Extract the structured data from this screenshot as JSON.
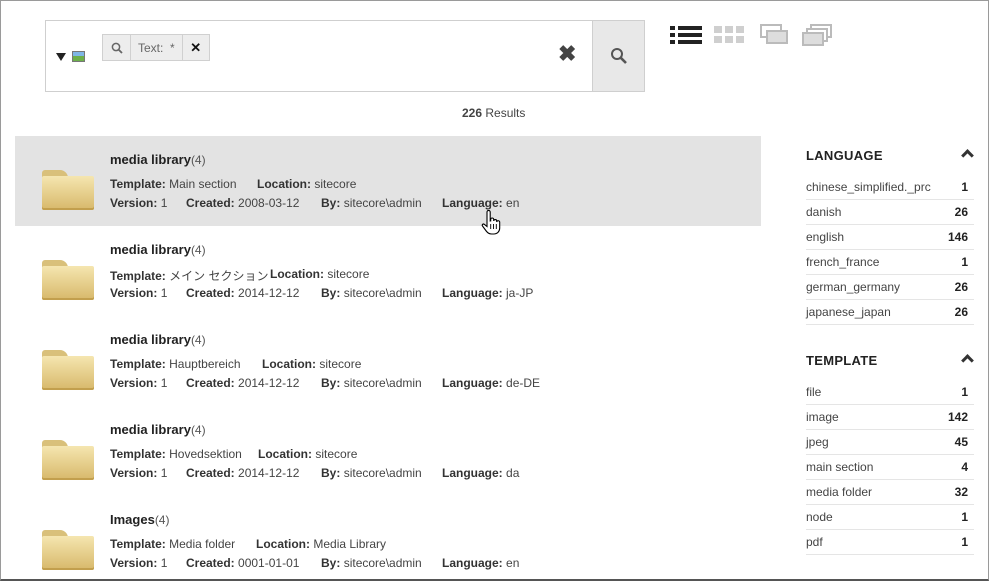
{
  "search": {
    "chip_label": "Text:",
    "chip_value": "*",
    "clear_label": "✖",
    "search_button_icon": "search-icon"
  },
  "results": {
    "count": "226",
    "label": "Results"
  },
  "items": [
    {
      "title": "media library",
      "count": "(4)",
      "template": "Main section",
      "location": "sitecore",
      "version": "1",
      "created": "2008-03-12",
      "by": "sitecore\\admin",
      "language": "en"
    },
    {
      "title": "media library",
      "count": "(4)",
      "template": "メイン セクション",
      "location": "sitecore",
      "version": "1",
      "created": "2014-12-12",
      "by": "sitecore\\admin",
      "language": "ja-JP"
    },
    {
      "title": "media library",
      "count": "(4)",
      "template": "Hauptbereich",
      "location": "sitecore",
      "version": "1",
      "created": "2014-12-12",
      "by": "sitecore\\admin",
      "language": "de-DE"
    },
    {
      "title": "media library",
      "count": "(4)",
      "template": "Hovedsektion",
      "location": "sitecore",
      "version": "1",
      "created": "2014-12-12",
      "by": "sitecore\\admin",
      "language": "da"
    },
    {
      "title": "Images",
      "count": "(4)",
      "template": "Media folder",
      "location": "Media Library",
      "version": "1",
      "created": "0001-01-01",
      "by": "sitecore\\admin",
      "language": "en"
    }
  ],
  "labels": {
    "template": "Template:",
    "location": "Location:",
    "version": "Version:",
    "created": "Created:",
    "by": "By:",
    "language": "Language:"
  },
  "facets": {
    "language": {
      "title": "LANGUAGE",
      "rows": [
        {
          "name": "chinese_simplified._prc",
          "count": "1"
        },
        {
          "name": "danish",
          "count": "26"
        },
        {
          "name": "english",
          "count": "146"
        },
        {
          "name": "french_france",
          "count": "1"
        },
        {
          "name": "german_germany",
          "count": "26"
        },
        {
          "name": "japanese_japan",
          "count": "26"
        }
      ]
    },
    "template": {
      "title": "TEMPLATE",
      "rows": [
        {
          "name": "file",
          "count": "1"
        },
        {
          "name": "image",
          "count": "142"
        },
        {
          "name": "jpeg",
          "count": "45"
        },
        {
          "name": "main section",
          "count": "4"
        },
        {
          "name": "media folder",
          "count": "32"
        },
        {
          "name": "node",
          "count": "1"
        },
        {
          "name": "pdf",
          "count": "1"
        }
      ]
    }
  },
  "colors": {
    "hover_bg": "#e3e3e3",
    "border": "#cfcfcf"
  }
}
